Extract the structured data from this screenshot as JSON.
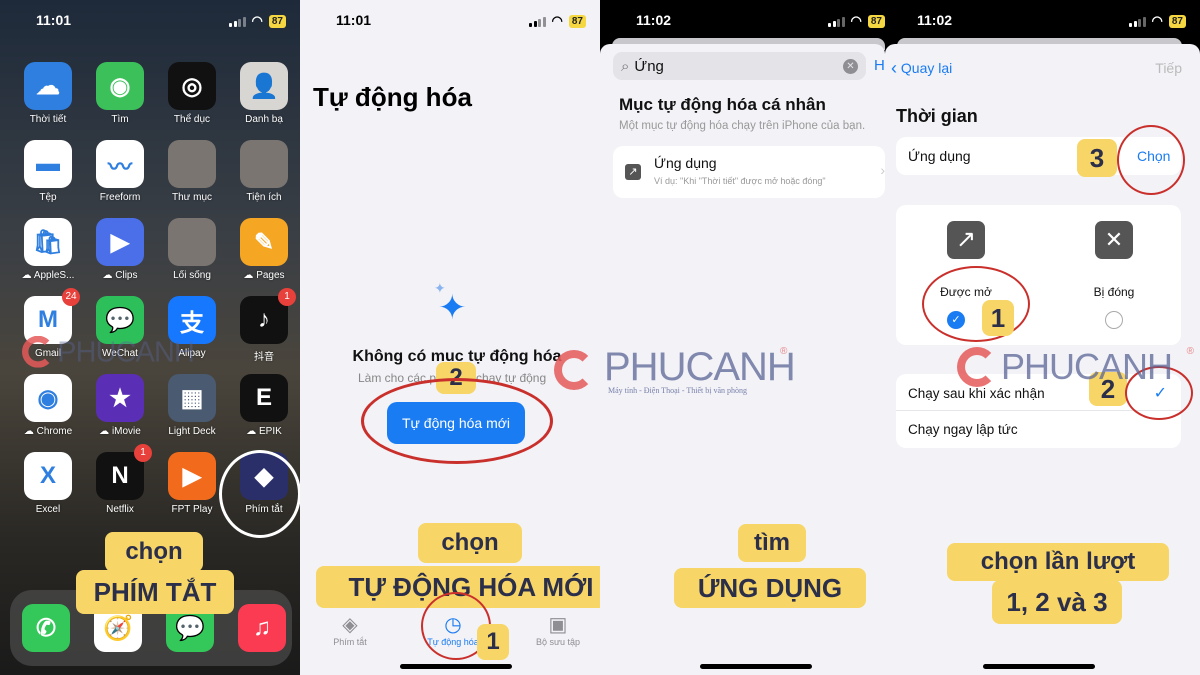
{
  "status_bar": {
    "panel1_time": "11:01",
    "panel2_time": "11:01",
    "panel3_time": "11:02",
    "panel4_time": "11:02",
    "battery": "87"
  },
  "home_screen": {
    "apps": [
      {
        "label": "Thời tiết",
        "icon": "weather-icon",
        "color": "#2f7fe0",
        "glyph": "☁",
        "badge": null,
        "cloud": false
      },
      {
        "label": "Tìm",
        "icon": "find-my-icon",
        "color": "#3cc05a",
        "glyph": "◉",
        "badge": null,
        "cloud": false
      },
      {
        "label": "Thể dục",
        "icon": "fitness-icon",
        "color": "#111111",
        "glyph": "◎",
        "badge": null,
        "cloud": false
      },
      {
        "label": "Danh bạ",
        "icon": "contacts-icon",
        "color": "#d8d6d2",
        "glyph": "👤",
        "badge": null,
        "cloud": false
      },
      {
        "label": "Tệp",
        "icon": "files-icon",
        "color": "#ffffff",
        "glyph": "▬",
        "badge": null,
        "cloud": false
      },
      {
        "label": "Freeform",
        "icon": "freeform-icon",
        "color": "#ffffff",
        "glyph": "〰",
        "badge": null,
        "cloud": false
      },
      {
        "label": "Thư mục",
        "icon": "folder-icon",
        "color": "#7a7570",
        "glyph": "",
        "badge": null,
        "cloud": false
      },
      {
        "label": "Tiện ích",
        "icon": "utilities-folder-icon",
        "color": "#7a7570",
        "glyph": "",
        "badge": null,
        "cloud": false
      },
      {
        "label": "AppleS...",
        "icon": "apple-store-icon",
        "color": "#ffffff",
        "glyph": "🛍",
        "badge": null,
        "cloud": true
      },
      {
        "label": "Clips",
        "icon": "clips-icon",
        "color": "#4a6fe8",
        "glyph": "▶",
        "badge": null,
        "cloud": true
      },
      {
        "label": "Lối sống",
        "icon": "lifestyle-folder-icon",
        "color": "#7a7570",
        "glyph": "",
        "badge": null,
        "cloud": false
      },
      {
        "label": "Pages",
        "icon": "pages-icon",
        "color": "#f5a623",
        "glyph": "✎",
        "badge": null,
        "cloud": true
      },
      {
        "label": "Gmail",
        "icon": "gmail-icon",
        "color": "#ffffff",
        "glyph": "M",
        "badge": "24",
        "cloud": false
      },
      {
        "label": "WeChat",
        "icon": "wechat-icon",
        "color": "#2dc05a",
        "glyph": "💬",
        "badge": null,
        "cloud": false
      },
      {
        "label": "Alipay",
        "icon": "alipay-icon",
        "color": "#1677ff",
        "glyph": "支",
        "badge": null,
        "cloud": false
      },
      {
        "label": "抖音",
        "icon": "douyin-icon",
        "color": "#111111",
        "glyph": "♪",
        "badge": "1",
        "cloud": false
      },
      {
        "label": "Chrome",
        "icon": "chrome-icon",
        "color": "#ffffff",
        "glyph": "◉",
        "badge": null,
        "cloud": true
      },
      {
        "label": "iMovie",
        "icon": "imovie-icon",
        "color": "#5b2fb5",
        "glyph": "★",
        "badge": null,
        "cloud": true
      },
      {
        "label": "Light Deck",
        "icon": "light-deck-icon",
        "color": "#4a5a70",
        "glyph": "▦",
        "badge": null,
        "cloud": false
      },
      {
        "label": "EPIK",
        "icon": "epik-icon",
        "color": "#111111",
        "glyph": "E",
        "badge": null,
        "cloud": true
      },
      {
        "label": "Excel",
        "icon": "excel-icon",
        "color": "#ffffff",
        "glyph": "X",
        "badge": null,
        "cloud": false
      },
      {
        "label": "Netflix",
        "icon": "netflix-icon",
        "color": "#111111",
        "glyph": "N",
        "badge": "1",
        "cloud": false
      },
      {
        "label": "FPT Play",
        "icon": "fpt-play-icon",
        "color": "#f26b1d",
        "glyph": "▶",
        "badge": null,
        "cloud": false
      },
      {
        "label": "Phím tắt",
        "icon": "shortcuts-icon",
        "color": "#2a2f6a",
        "glyph": "◆",
        "badge": null,
        "cloud": false
      }
    ],
    "dock": [
      {
        "icon": "phone-icon",
        "color": "#34c759",
        "glyph": "✆"
      },
      {
        "icon": "safari-icon",
        "color": "#ffffff",
        "glyph": "🧭"
      },
      {
        "icon": "messages-icon",
        "color": "#34c759",
        "glyph": "💬"
      },
      {
        "icon": "music-icon",
        "color": "#fa3b52",
        "glyph": "♫"
      }
    ],
    "caption_line1": "chọn",
    "caption_line2": "PHÍM TẮT"
  },
  "automation_screen": {
    "title": "Tự động hóa",
    "empty_title": "Không có mục tự động hóa",
    "empty_subtitle": "Làm cho các phím tắt chạy tự động",
    "new_button": "Tự động hóa mới",
    "step_badge_button": "2",
    "step_badge_tab": "1",
    "caption_line1": "chọn",
    "caption_line2": "TỰ ĐỘNG HÓA MỚI",
    "tabs": [
      {
        "label": "Phím tắt",
        "icon": "layers-icon",
        "active": false
      },
      {
        "label": "Tự động hóa",
        "icon": "automation-clock-icon",
        "active": true
      },
      {
        "label": "Bộ sưu tập",
        "icon": "gallery-icon",
        "active": false
      }
    ]
  },
  "search_screen": {
    "search_value": "Ứng",
    "cancel_label": "H",
    "section_title": "Mục tự động hóa cá nhân",
    "section_subtitle": "Một mục tự động hóa chạy trên iPhone của bạn.",
    "result_title": "Ứng dụng",
    "result_subtitle": "Ví dụ: \"Khi \"Thời tiết\" được mở hoặc đóng\"",
    "caption_line1": "tìm",
    "caption_line2": "ỨNG DỤNG"
  },
  "config_screen": {
    "back_label": "Quay lại",
    "next_label": "Tiếp",
    "section_title": "Thời gian",
    "app_row_label": "Ứng dụng",
    "choose_label": "Chọn",
    "opened_label": "Được mở",
    "opened_checked": true,
    "closed_label": "Bị đóng",
    "closed_checked": false,
    "run_after_confirm": "Chạy sau khi xác nhận",
    "run_after_confirm_checked": true,
    "run_immediately": "Chạy ngay lập tức",
    "step1": "1",
    "step2": "2",
    "step3": "3",
    "caption_line1": "chọn lần lượt",
    "caption_line2": "1, 2 và 3"
  },
  "watermark": {
    "brand": "PHUCANH",
    "tagline": "Máy tính - Điện Thoại - Thiết bị văn phòng",
    "registered": "®"
  },
  "colors": {
    "ios_blue": "#1a7cf2",
    "caption_yellow": "#f7d566",
    "caption_text": "#2b2f4a",
    "annotation_red": "#c9302c"
  }
}
